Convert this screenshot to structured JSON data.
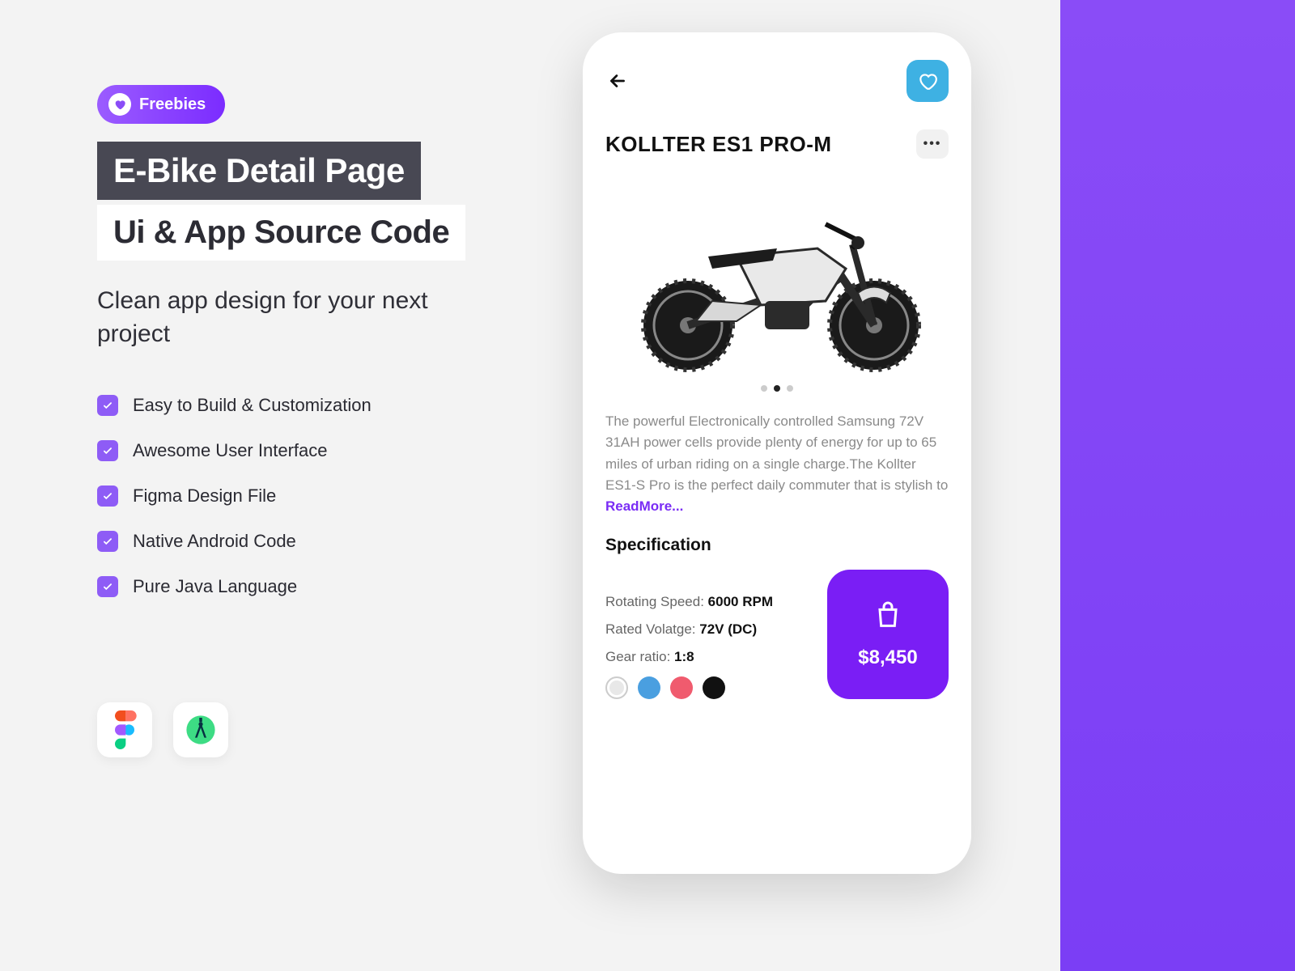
{
  "promo": {
    "freebies_label": "Freebies",
    "headline_dark": "E-Bike Detail Page",
    "headline_light": "Ui & App Source Code",
    "subtitle": "Clean app design for your next project",
    "checklist": [
      "Easy to Build & Customization",
      "Awesome User Interface",
      "Figma Design File",
      "Native Android Code",
      "Pure Java Language"
    ]
  },
  "product": {
    "title": "KOLLTER ES1 PRO-M",
    "description": "The powerful Electronically controlled Samsung 72V 31AH power cells provide plenty of energy for up to 65 miles of urban riding on a single charge.The Kollter ES1-S Pro is the perfect daily commuter that is stylish to ",
    "readmore": "ReadMore...",
    "spec_heading": "Specification",
    "specs": {
      "rotating_label": "Rotating Speed:",
      "rotating_value": "6000 RPM",
      "voltage_label": "Rated Volatge:",
      "voltage_value": "72V (DC)",
      "gear_label": "Gear ratio:",
      "gear_value": "1:8"
    },
    "colors": [
      "#e8e8e8",
      "#4a9fe0",
      "#f05b6e",
      "#111111"
    ],
    "selected_color_index": 0,
    "pager_active_index": 1,
    "price": "$8,450"
  },
  "colors": {
    "accent": "#7a1ef5",
    "fav_bg": "#3eb1e3"
  }
}
